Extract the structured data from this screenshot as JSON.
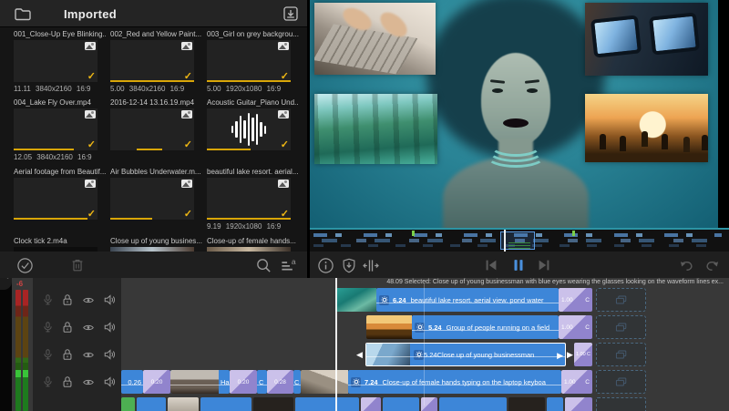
{
  "colors": {
    "accent_blue": "#3d86d8",
    "transition_purple_light": "#cbc1ea",
    "transition_purple_dark": "#9184cd",
    "check_yellow": "#f0b814",
    "meter_red": "#cf4343",
    "overview_teal": "#2c93a4"
  },
  "library": {
    "header": {
      "title": "Imported"
    },
    "items": [
      {
        "name": "001_Close-Up Eye Blinking...",
        "meta": "11.11 3840x2160 16:9"
      },
      {
        "name": "002_Red and Yellow Paint...",
        "meta": "5.00 3840x2160 16:9"
      },
      {
        "name": "003_Girl on grey backgrou...",
        "meta": "5.00 1920x1080 16:9"
      },
      {
        "name": "004_Lake Fly Over.mp4",
        "meta": "12.05 3840x2160 16:9"
      },
      {
        "name": "2016-12-14 13.16.19.mp4",
        "meta": ""
      },
      {
        "name": "Acoustic Guitar_Piano Und...",
        "meta": ""
      },
      {
        "name": "Aerial footage from Beautif...",
        "meta": ""
      },
      {
        "name": "Air Bubbles Underwater.m...",
        "meta": ""
      },
      {
        "name": "beautiful lake resort. aerial...",
        "meta": "9.19 1920x1080 16:9"
      },
      {
        "name": "Clock tick 2.m4a",
        "meta": ""
      },
      {
        "name": "Close up of young busines...",
        "meta": ""
      },
      {
        "name": "Close-up of female hands...",
        "meta": ""
      }
    ]
  },
  "icons": {
    "library_header": [
      "folder-icon",
      "import-icon"
    ],
    "library_toolbar": [
      "select-all-icon",
      "trash-icon",
      "search-icon",
      "sort-alpha-icon"
    ],
    "timeline_toolbar": [
      "info-icon",
      "shield-import-icon",
      "trim-icon"
    ],
    "transport": [
      "skip-back-icon",
      "pause-icon",
      "skip-forward-icon"
    ],
    "history": [
      "undo-icon",
      "redo-icon"
    ],
    "track_controls": [
      "mic-icon",
      "lock-icon",
      "eye-icon",
      "speaker-icon"
    ],
    "clip": [
      "gear-icon"
    ],
    "ghost_slot": [
      "duplicate-icon"
    ],
    "thumb_badges": [
      "photo-icon",
      "check-icon"
    ]
  },
  "timeline": {
    "meter_label": "-6",
    "status": "48.09 Selected: Close up of young businessman with blue eyes wearing the glasses looking on the waveform lines ex...",
    "clips": [
      {
        "duration": "6.24",
        "label": "beautiful lake resort. aerial view. pond water",
        "speed": "1.00",
        "mode": "C"
      },
      {
        "duration": "5.24",
        "label": "Group of people running on a field",
        "speed": "1.00",
        "mode": "C"
      },
      {
        "duration": "5.24",
        "label": "Close up of young businessman",
        "speed": "1.00",
        "mode": "C"
      },
      {
        "duration": "7.24",
        "label": "Close-up of female hands typing on the laptop keyboa",
        "speed": "1.00",
        "mode": "C"
      }
    ],
    "small": [
      {
        "label": "0.26"
      },
      {
        "label": "0.20"
      },
      {
        "label": "Hap"
      },
      {
        "label": "0.20"
      },
      {
        "label": "C"
      },
      {
        "label": "0.28"
      },
      {
        "label": "C"
      }
    ]
  }
}
